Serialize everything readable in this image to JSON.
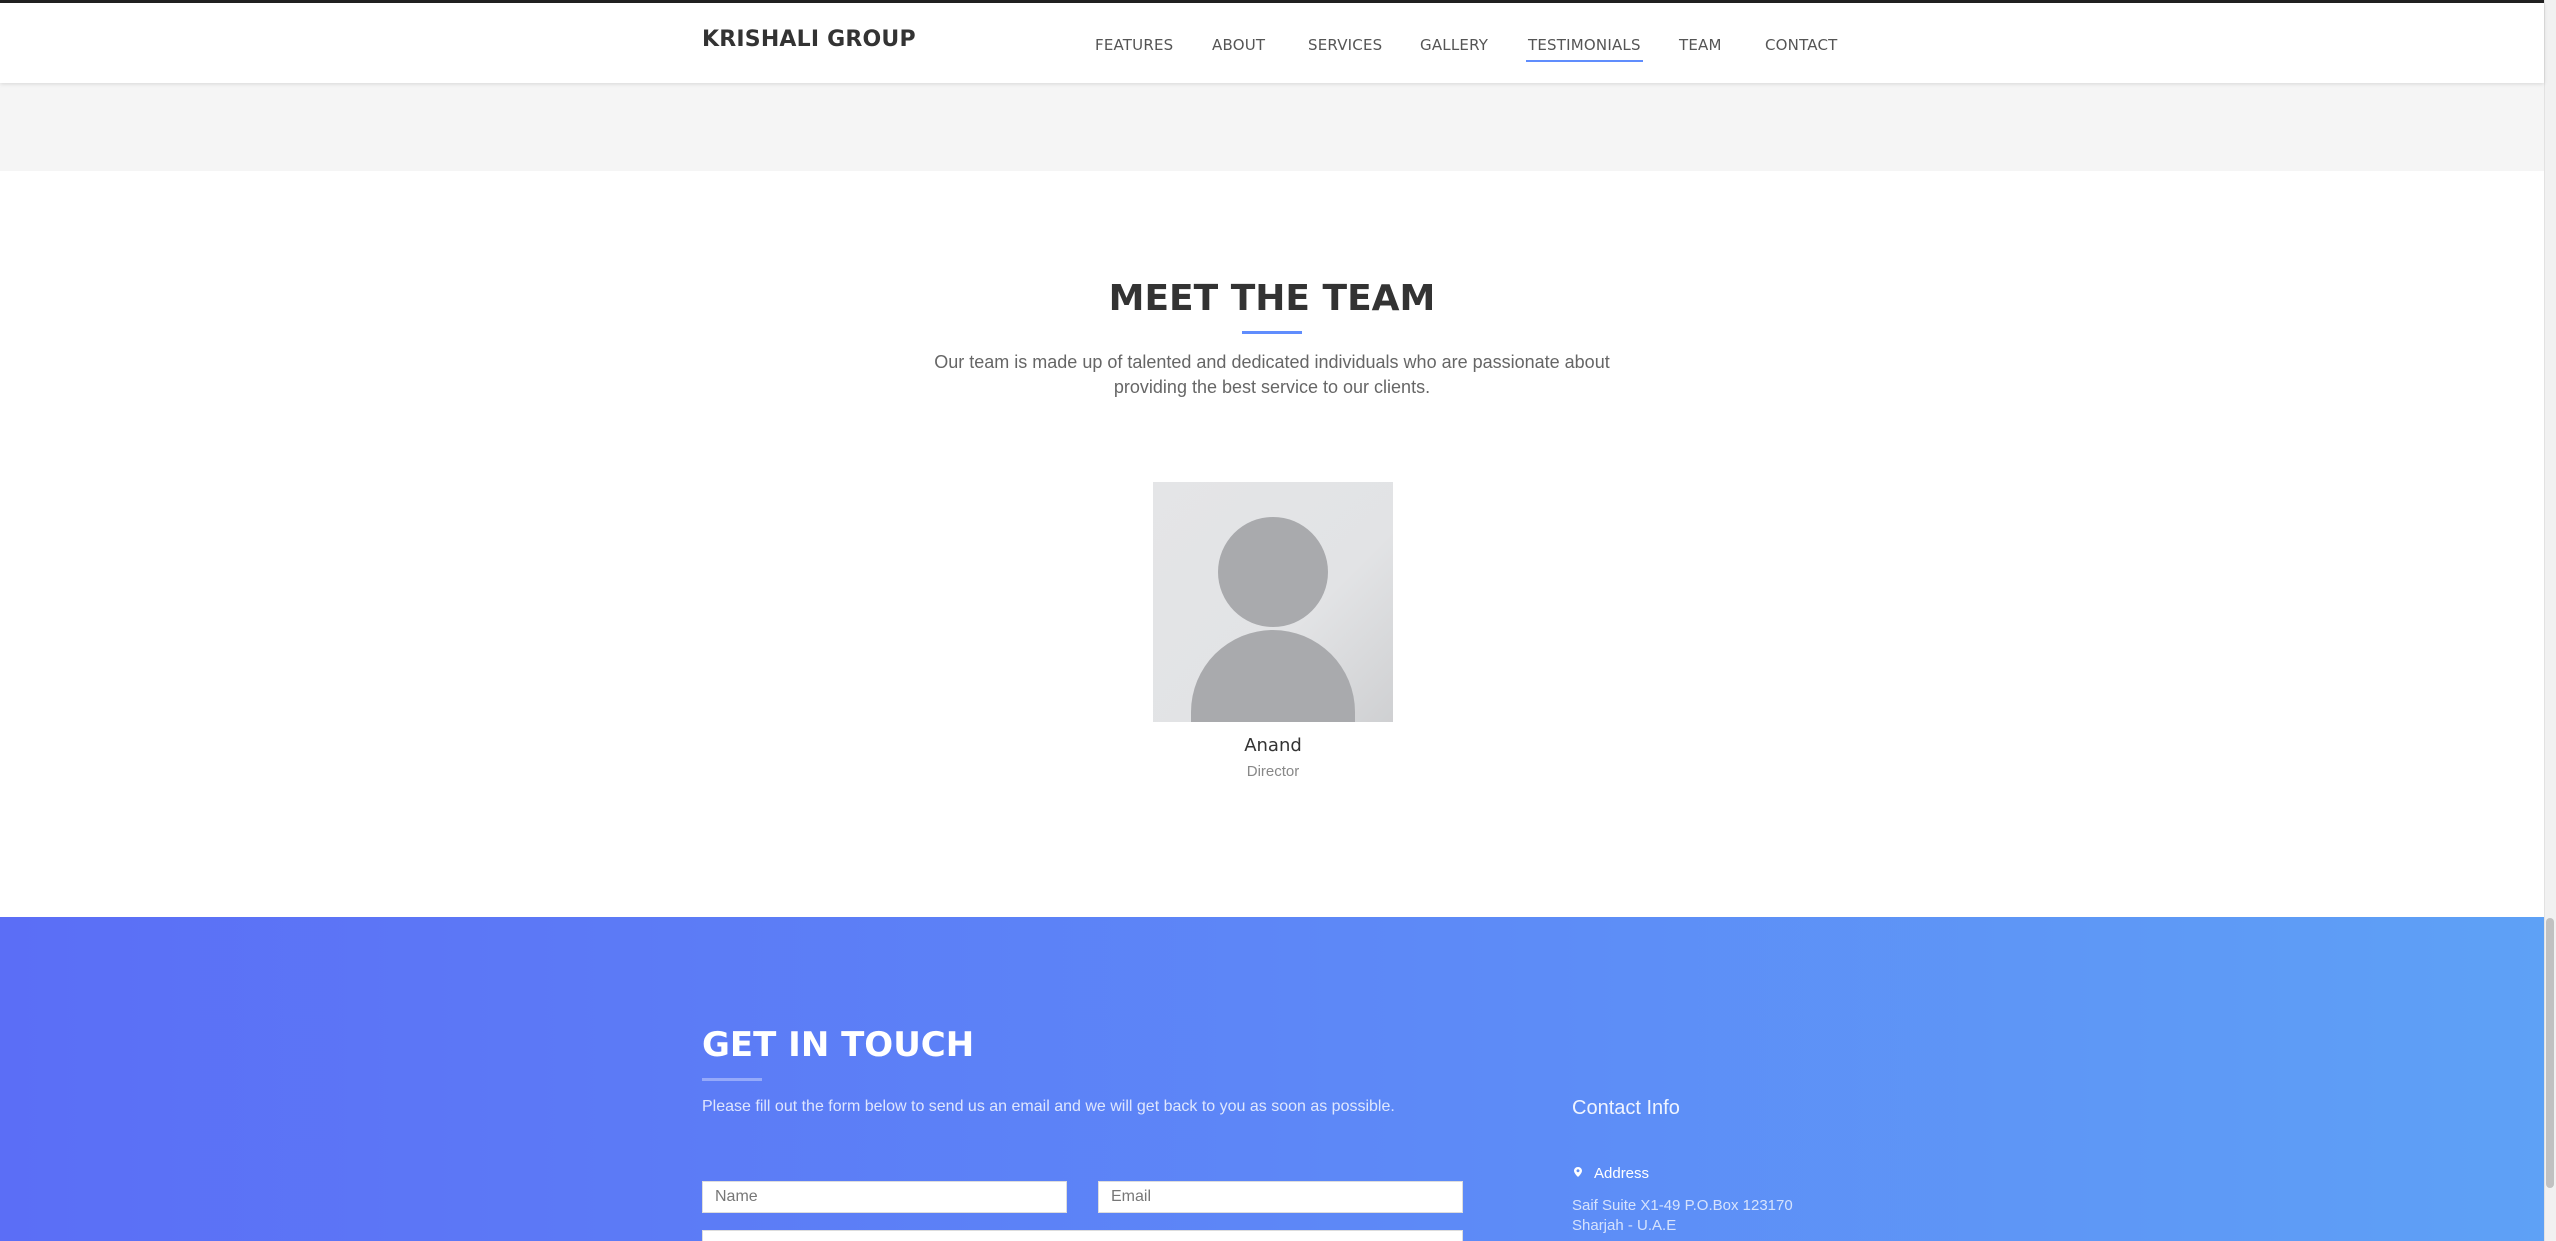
{
  "nav": {
    "brand": "KRISHALI GROUP",
    "items": [
      {
        "label": "FEATURES"
      },
      {
        "label": "ABOUT"
      },
      {
        "label": "SERVICES"
      },
      {
        "label": "GALLERY"
      },
      {
        "label": "TESTIMONIALS",
        "active": true
      },
      {
        "label": "TEAM"
      },
      {
        "label": "CONTACT"
      }
    ]
  },
  "team": {
    "title": "MEET THE TEAM",
    "description": "Our team is made up of talented and dedicated individuals who are passionate about providing the best service to our clients.",
    "members": [
      {
        "name": "Anand",
        "role": "Director",
        "avatar_icon": "person-placeholder-icon"
      }
    ]
  },
  "contact": {
    "title": "GET IN TOUCH",
    "description": "Please fill out the form below to send us an email and we will get back to you as soon as possible.",
    "form": {
      "name_placeholder": "Name",
      "email_placeholder": "Email",
      "message_placeholder": ""
    },
    "info": {
      "title": "Contact Info",
      "address_label": "Address",
      "address_icon": "map-pin-icon",
      "address_lines": [
        "Saif Suite X1-49 P.O.Box 123170",
        "Sharjah - U.A.E"
      ]
    }
  },
  "colors": {
    "accent": "#608dfd",
    "gradient_start": "#5b6ef6",
    "gradient_end": "#5ea1f6"
  }
}
